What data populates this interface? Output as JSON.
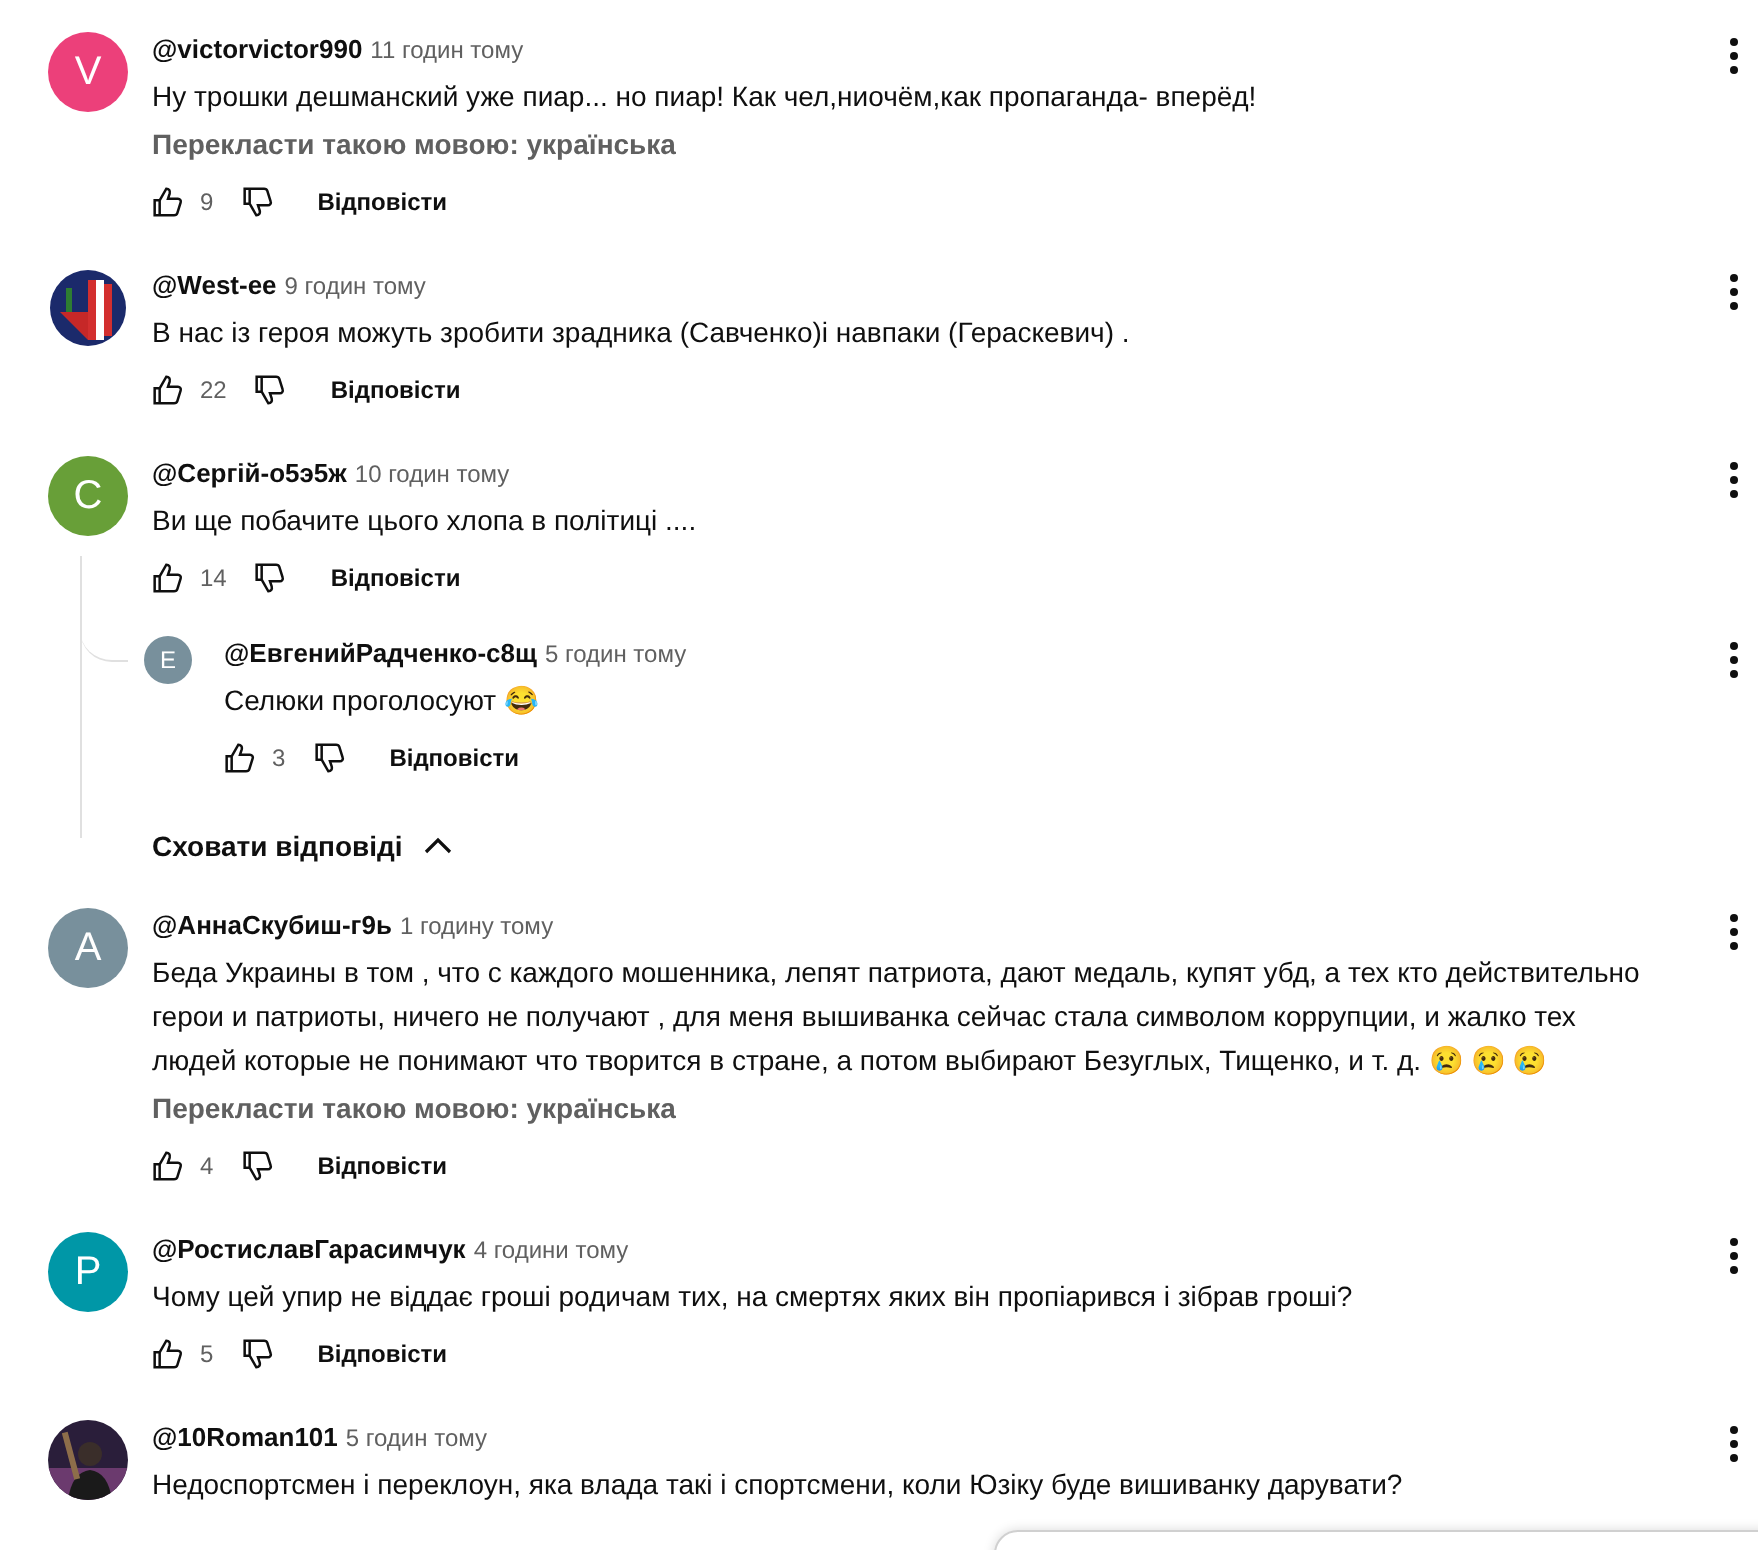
{
  "comments": [
    {
      "author": "@victorvictor990",
      "time": "11 годин тому",
      "avatar": {
        "kind": "letter",
        "letter": "V",
        "color": "#ec407a"
      },
      "text": "Ну трошки дешманский уже пиар... но пиар! Как чел,ниочём,как пропаганда- вперёд!",
      "translate": "Перекласти такою мовою: українська",
      "likes": "9",
      "reply_label": "Відповісти"
    },
    {
      "author": "@West-ee",
      "time": "9 годин тому",
      "text": "В нас із героя можуть зробити зрадника (Савченко)і навпаки (Гераскевич) .",
      "likes": "22",
      "reply_label": "Відповісти"
    },
    {
      "author": "@Сергій-о5э5ж",
      "time": "10 годин тому",
      "avatar": {
        "kind": "letter",
        "letter": "C",
        "color": "#689f38"
      },
      "text": "Ви ще побачите цього хлопа в політиці ....",
      "likes": "14",
      "reply_label": "Відповісти",
      "replies": [
        {
          "author": "@ЕвгенийРадченко-с8щ",
          "time": "5 годин тому",
          "avatar": {
            "kind": "letter",
            "letter": "E",
            "color": "#78909c"
          },
          "text": "Селюки проголосуют 😂",
          "likes": "3",
          "reply_label": "Відповісти"
        }
      ],
      "hide_replies": "Сховати відповіді"
    },
    {
      "author": "@АннаСкубиш-г9ь",
      "time": "1 годину тому",
      "avatar": {
        "kind": "letter",
        "letter": "A",
        "color": "#78909c"
      },
      "text": "Беда Украины в том , что с каждого мошенника, лепят патриота, дают медаль, купят убд, а тех кто действительно герои и патриоты, ничего не получают , для меня вышиванка сейчас стала символом коррупции, и жалко тех людей которые не понимают что творится в стране, а потом выбирают Безуглых, Тищенко, и т. д. 😢 😢 😢",
      "translate": "Перекласти такою мовою: українська",
      "likes": "4",
      "reply_label": "Відповісти"
    },
    {
      "author": "@РостиславГарасимчук",
      "time": "4 години тому",
      "avatar": {
        "kind": "letter",
        "letter": "P",
        "color": "#0097a7"
      },
      "text": "Чому цей упир не віддає гроші родичам тих, на смертях яких він пропіарився і зібрав гроші?",
      "likes": "5",
      "reply_label": "Відповісти"
    },
    {
      "author": "@10Roman101",
      "time": "5 годин тому",
      "text": "Недоспортсмен і переклоун, яка влада такі і спортсмени, коли Юзіку буде вишиванку дарувати?"
    }
  ],
  "popup": {
    "kind": "panel"
  }
}
